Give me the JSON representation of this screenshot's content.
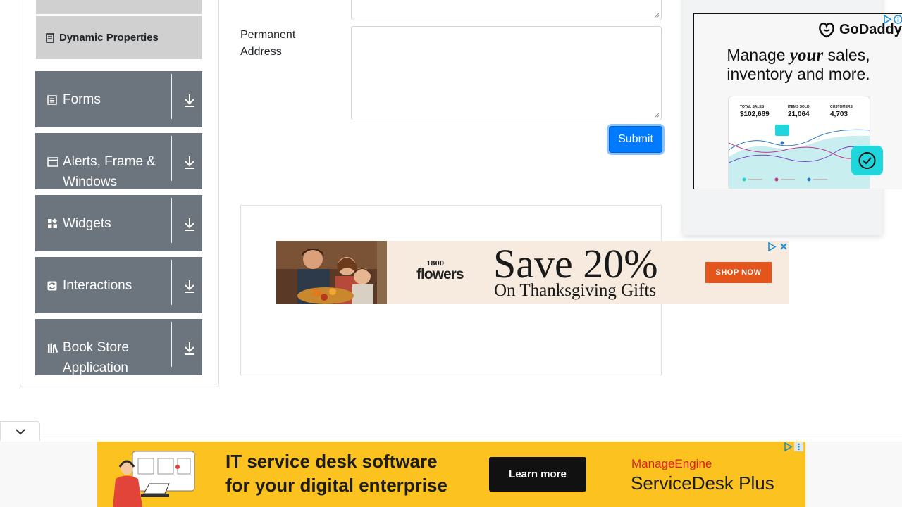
{
  "sidebar": {
    "sub_items": [
      {
        "label": "Dynamic Properties",
        "icon": "doc-icon"
      }
    ],
    "groups": [
      {
        "label": "Forms",
        "icon": "form-icon"
      },
      {
        "label": "Alerts, Frame & Windows",
        "icon": "window-icon"
      },
      {
        "label": "Widgets",
        "icon": "widgets-icon"
      },
      {
        "label": "Interactions",
        "icon": "interactions-icon"
      },
      {
        "label": "Book Store Application",
        "icon": "book-icon"
      }
    ]
  },
  "form": {
    "permanent_address_label": "Permanent Address",
    "permanent_address_value": "",
    "submit_label": "Submit"
  },
  "ads": {
    "flowers": {
      "logo_number": "1800",
      "logo_word": "flowers",
      "headline": "Save 20%",
      "subline": "On Thanksgiving Gifts",
      "cta": "SHOP NOW"
    },
    "godaddy": {
      "brand": "GoDaddy",
      "headline_pre": "Manage ",
      "headline_em": "your",
      "headline_post": " sales,",
      "headline_line2": "inventory and more.",
      "stats": [
        {
          "label": "TOTAL SALES",
          "value": "$102,689"
        },
        {
          "label": "ITEMS SOLD",
          "value": "21,064"
        },
        {
          "label": "CUSTOMERS",
          "value": "4,703"
        }
      ]
    },
    "servicedesk": {
      "line1": "IT service desk software",
      "line2": "for your digital enterprise",
      "cta": "Learn more",
      "brand_top": "ManageEngine",
      "brand_bottom": "ServiceDesk Plus"
    }
  },
  "colors": {
    "sidebar_group_bg": "#6c757d",
    "primary": "#007bff",
    "ad_yellow": "#fcc220",
    "shop_orange": "#e4551b"
  }
}
